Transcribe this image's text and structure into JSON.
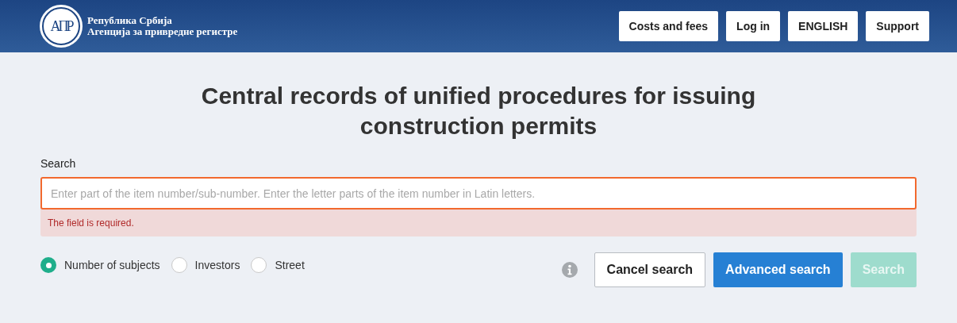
{
  "header": {
    "logo_text": "АПР",
    "agency_lines": [
      "Република Србија",
      "Агенција за привредне регистре"
    ],
    "nav_buttons": [
      "Costs and fees",
      "Log in",
      "ENGLISH",
      "Support"
    ]
  },
  "title": "Central records of unified procedures for issuing construction permits",
  "search": {
    "label": "Search",
    "placeholder": "Enter part of the item number/sub-number. Enter the letter parts of the item number in Latin letters.",
    "invalid": true,
    "error": "The field is required."
  },
  "search_by": [
    {
      "label": "Number of subjects",
      "selected": true
    },
    {
      "label": "Investors",
      "selected": false
    },
    {
      "label": "Street",
      "selected": false
    }
  ],
  "actions": [
    {
      "label": "Cancel search",
      "kind": "outline",
      "disabled": false
    },
    {
      "label": "Advanced search",
      "kind": "primary",
      "disabled": false
    },
    {
      "label": "Search",
      "kind": "success",
      "disabled": true
    }
  ]
}
